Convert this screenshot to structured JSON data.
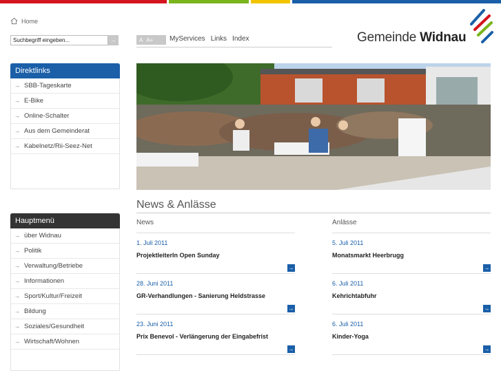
{
  "colors": {
    "red": "#d4141e",
    "green": "#7ab51d",
    "yellow": "#f2c400",
    "blue": "#1a5fa8",
    "dark": "#333333"
  },
  "breadcrumb": {
    "home_label": "Home"
  },
  "search": {
    "value": "Suchbegriff eingeben...",
    "go_icon": "arrow-right-icon"
  },
  "fontsize": {
    "small": "A",
    "large": "A+"
  },
  "topnav": {
    "items": [
      "MyServices",
      "Links",
      "Index"
    ]
  },
  "logo": {
    "text_regular": "Gemeinde",
    "text_bold": "Widnau"
  },
  "direktlinks": {
    "title": "Direktlinks",
    "items": [
      "SBB-Tageskarte",
      "E-Bike",
      "Online-Schalter",
      "Aus dem Gemeinderat",
      "Kabelnetz/Rii-Seez-Net"
    ]
  },
  "hauptmenu": {
    "title": "Hauptmenü",
    "items": [
      "über Widnau",
      "Politik",
      "Verwaltung/Betriebe",
      "Informationen",
      "Sport/Kultur/Freizeit",
      "Bildung",
      "Soziales/Gesundheit",
      "Wirtschaft/Wohnen"
    ]
  },
  "news_section": {
    "title": "News & Anlässe"
  },
  "news": {
    "header": "News",
    "entries": [
      {
        "date": "1. Juli 2011",
        "title": "ProjektleiterIn Open Sunday"
      },
      {
        "date": "28. Juni 2011",
        "title": "GR-Verhandlungen - Sanierung Heldstrasse"
      },
      {
        "date": "23. Juni 2011",
        "title": "Prix Benevol - Verlängerung der Eingabefrist"
      }
    ]
  },
  "anlaesse": {
    "header": "Anlässe",
    "entries": [
      {
        "date": "5. Juli 2011",
        "title": "Monatsmarkt Heerbrugg"
      },
      {
        "date": "6. Juli 2011",
        "title": "Kehrichtabfuhr"
      },
      {
        "date": "6. Juli 2011",
        "title": "Kinder-Yoga"
      }
    ]
  }
}
